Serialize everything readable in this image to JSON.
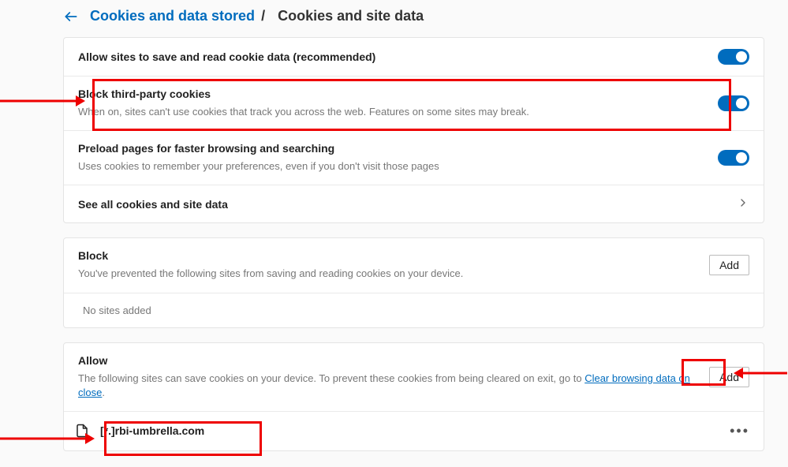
{
  "breadcrumb": {
    "link": "Cookies and data stored",
    "current": "Cookies and site data"
  },
  "settings": {
    "allow_save": {
      "title": "Allow sites to save and read cookie data (recommended)"
    },
    "block_third": {
      "title": "Block third-party cookies",
      "sub": "When on, sites can't use cookies that track you across the web. Features on some sites may break."
    },
    "preload": {
      "title": "Preload pages for faster browsing and searching",
      "sub": "Uses cookies to remember your preferences, even if you don't visit those pages"
    },
    "see_all": {
      "title": "See all cookies and site data"
    }
  },
  "block_section": {
    "title": "Block",
    "sub": "You've prevented the following sites from saving and reading cookies on your device.",
    "add": "Add",
    "empty": "No sites added"
  },
  "allow_section": {
    "title": "Allow",
    "sub_before": "The following sites can save cookies on your device. To prevent these cookies from being cleared on exit, go to ",
    "sub_link": "Clear browsing data on close",
    "sub_after": ".",
    "add": "Add",
    "site": "[*.]rbi-umbrella.com"
  }
}
